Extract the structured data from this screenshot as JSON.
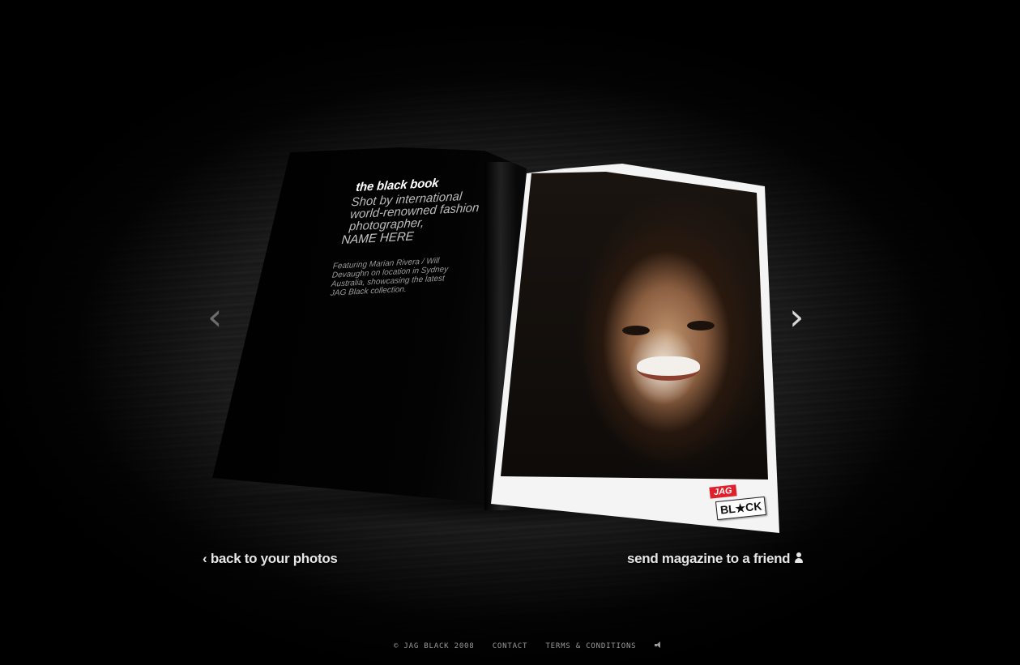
{
  "magazine": {
    "left_page": {
      "title": "the black book",
      "subtitle": "Shot by international\nworld-renowned fashion\nphotographer,",
      "photographer_name": "NAME HERE",
      "description": "Featuring Marian Rivera / Will\nDevaughn on location in Sydney\nAustralia, showcasing the latest\nJAG Black collection."
    },
    "right_page": {
      "logo_top": "JAG",
      "logo_bottom": "BL★CK"
    }
  },
  "navigation": {
    "prev_arrow": "‹",
    "next_arrow": "›"
  },
  "links": {
    "back": "back to your photos",
    "back_glyph": "‹",
    "send": "send magazine to a friend"
  },
  "footer": {
    "copyright": "© JAG BLACK 2008",
    "contact": "CONTACT",
    "terms": "TERMS & CONDITIONS"
  },
  "icons": [
    "chevron-left-icon",
    "chevron-right-icon",
    "person-icon",
    "speaker-icon"
  ],
  "colors": {
    "background": "#000000",
    "text": "#e6e6e6",
    "brand_red": "#e0202a"
  }
}
